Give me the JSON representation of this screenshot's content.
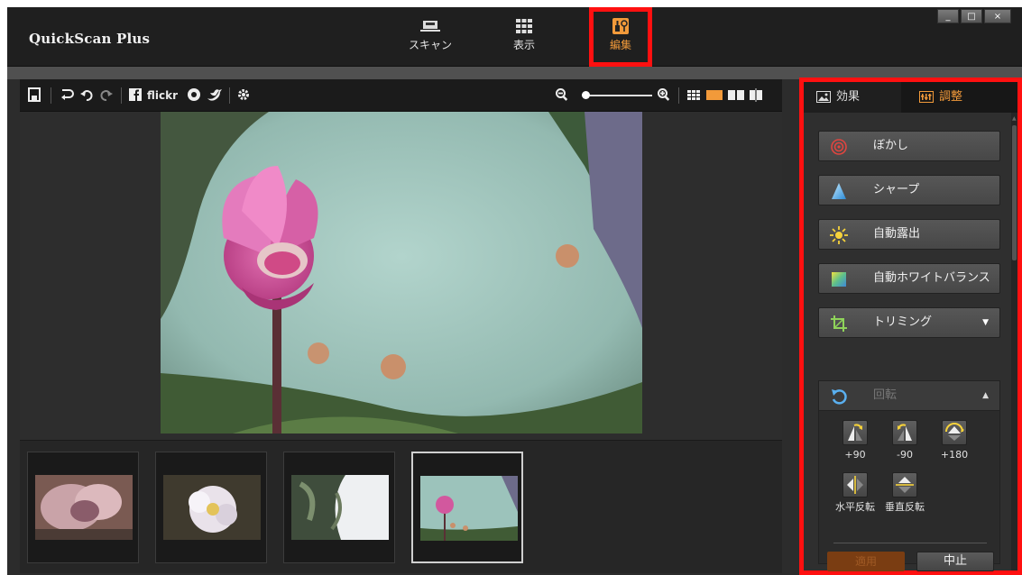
{
  "app": {
    "title": "QuickScan Plus"
  },
  "modes": [
    {
      "label": "スキャン",
      "icon": "scanner-icon"
    },
    {
      "label": "表示",
      "icon": "grid-view-icon"
    },
    {
      "label": "編集",
      "icon": "edit-tools-icon",
      "active": true
    }
  ],
  "window_controls": [
    "_",
    "□",
    "×"
  ],
  "toolbar": {
    "share_flickr": "flickr"
  },
  "zoom": {
    "level": 0.05
  },
  "filmstrip": {
    "thumbnails": [
      {
        "subject": "pink-rose-closeup"
      },
      {
        "subject": "white-flower"
      },
      {
        "subject": "leaves-and-sky"
      },
      {
        "subject": "pink-lotus",
        "selected": true
      }
    ]
  },
  "panel": {
    "tabs": [
      {
        "label": "効果",
        "active": false
      },
      {
        "label": "調整",
        "active": true
      }
    ],
    "tools": [
      {
        "label": "ぼかし",
        "icon": "blur-target-icon"
      },
      {
        "label": "シャープ",
        "icon": "sharpen-triangle-icon"
      },
      {
        "label": "自動露出",
        "icon": "sun-icon"
      },
      {
        "label": "自動ホワイトバランス",
        "icon": "white-balance-icon"
      },
      {
        "label": "トリミング",
        "icon": "crop-icon"
      }
    ],
    "rotate": {
      "title": "回転",
      "buttons": [
        {
          "label": "+90"
        },
        {
          "label": "-90"
        },
        {
          "label": "+180"
        },
        {
          "label": "水平反転"
        },
        {
          "label": "垂直反転"
        }
      ],
      "apply_label": "適用",
      "cancel_label": "中止"
    }
  },
  "colors": {
    "accent": "#f29a3a",
    "highlight": "#ff1010",
    "background": "#2c2c2c"
  }
}
